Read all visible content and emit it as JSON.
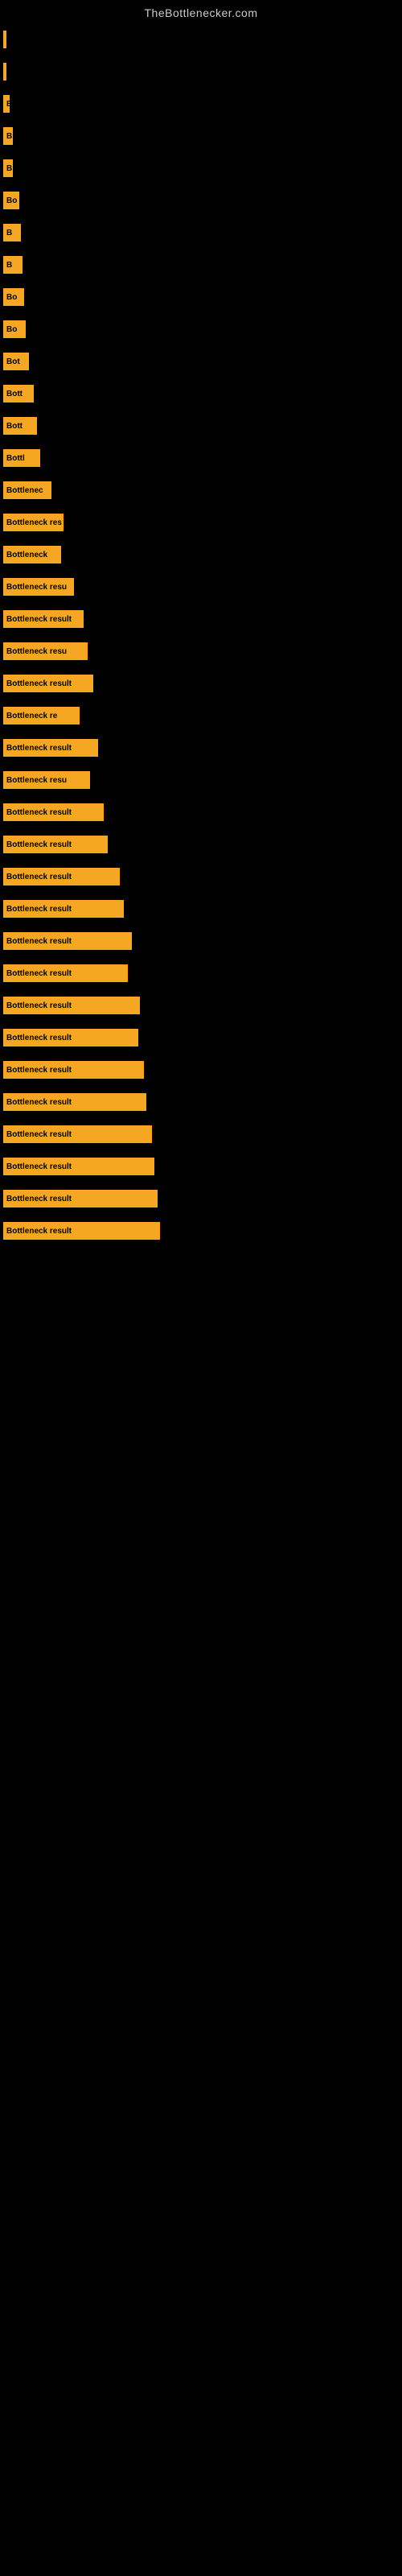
{
  "site": {
    "title": "TheBottlenecker.com"
  },
  "bars": [
    {
      "id": 1,
      "width": 4,
      "label": ""
    },
    {
      "id": 2,
      "width": 4,
      "label": ""
    },
    {
      "id": 3,
      "width": 8,
      "label": "B"
    },
    {
      "id": 4,
      "width": 12,
      "label": "B"
    },
    {
      "id": 5,
      "width": 12,
      "label": "B"
    },
    {
      "id": 6,
      "width": 20,
      "label": "Bo"
    },
    {
      "id": 7,
      "width": 22,
      "label": "B"
    },
    {
      "id": 8,
      "width": 24,
      "label": "B"
    },
    {
      "id": 9,
      "width": 26,
      "label": "Bo"
    },
    {
      "id": 10,
      "width": 28,
      "label": "Bo"
    },
    {
      "id": 11,
      "width": 32,
      "label": "Bot"
    },
    {
      "id": 12,
      "width": 38,
      "label": "Bott"
    },
    {
      "id": 13,
      "width": 42,
      "label": "Bott"
    },
    {
      "id": 14,
      "width": 46,
      "label": "Bottl"
    },
    {
      "id": 15,
      "width": 60,
      "label": "Bottlenec"
    },
    {
      "id": 16,
      "width": 75,
      "label": "Bottleneck res"
    },
    {
      "id": 17,
      "width": 72,
      "label": "Bottleneck"
    },
    {
      "id": 18,
      "width": 88,
      "label": "Bottleneck resu"
    },
    {
      "id": 19,
      "width": 100,
      "label": "Bottleneck result"
    },
    {
      "id": 20,
      "width": 105,
      "label": "Bottleneck resu"
    },
    {
      "id": 21,
      "width": 112,
      "label": "Bottleneck result"
    },
    {
      "id": 22,
      "width": 95,
      "label": "Bottleneck re"
    },
    {
      "id": 23,
      "width": 118,
      "label": "Bottleneck result"
    },
    {
      "id": 24,
      "width": 108,
      "label": "Bottleneck resu"
    },
    {
      "id": 25,
      "width": 125,
      "label": "Bottleneck result"
    },
    {
      "id": 26,
      "width": 130,
      "label": "Bottleneck result"
    },
    {
      "id": 27,
      "width": 145,
      "label": "Bottleneck result"
    },
    {
      "id": 28,
      "width": 150,
      "label": "Bottleneck result"
    },
    {
      "id": 29,
      "width": 160,
      "label": "Bottleneck result"
    },
    {
      "id": 30,
      "width": 155,
      "label": "Bottleneck result"
    },
    {
      "id": 31,
      "width": 170,
      "label": "Bottleneck result"
    },
    {
      "id": 32,
      "width": 168,
      "label": "Bottleneck result"
    },
    {
      "id": 33,
      "width": 175,
      "label": "Bottleneck result"
    },
    {
      "id": 34,
      "width": 178,
      "label": "Bottleneck result"
    },
    {
      "id": 35,
      "width": 185,
      "label": "Bottleneck result"
    },
    {
      "id": 36,
      "width": 188,
      "label": "Bottleneck result"
    },
    {
      "id": 37,
      "width": 192,
      "label": "Bottleneck result"
    },
    {
      "id": 38,
      "width": 195,
      "label": "Bottleneck result"
    }
  ]
}
